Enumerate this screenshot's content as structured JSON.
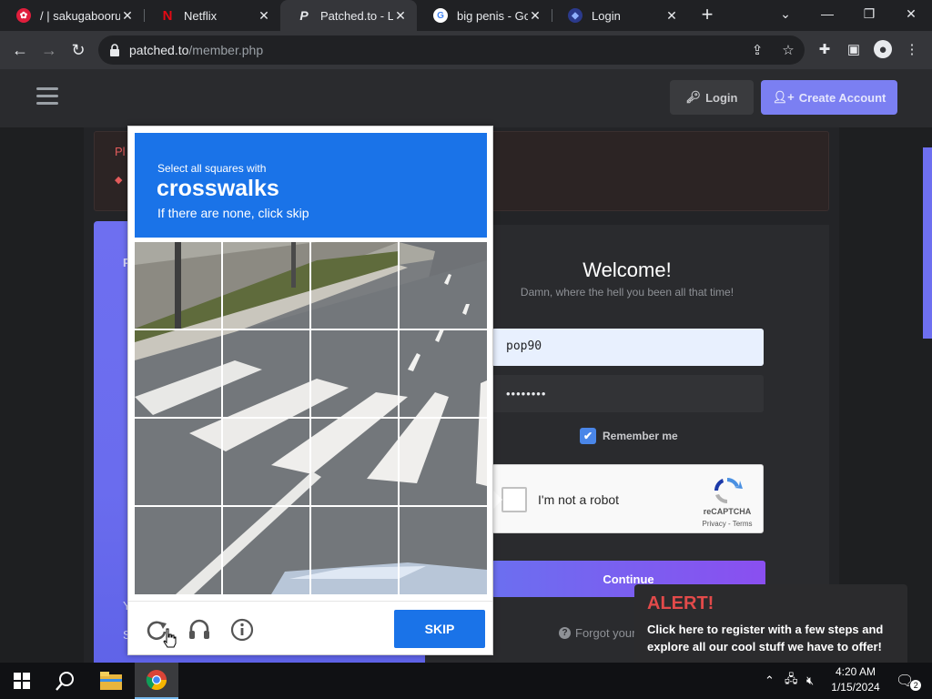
{
  "browser": {
    "tabs": [
      {
        "title": "/ | sakugabooru",
        "favicon": "sakugabooru-icon"
      },
      {
        "title": "Netflix",
        "favicon": "netflix-icon"
      },
      {
        "title": "Patched.to - Lo",
        "favicon": "patched-icon"
      },
      {
        "title": "big penis - Goo",
        "favicon": "google-icon"
      },
      {
        "title": "Login",
        "favicon": "login-icon"
      }
    ],
    "url_host": "patched.to",
    "url_path": "/member.php"
  },
  "site": {
    "login_label": "Login",
    "create_label": "Create Account",
    "error_text": "Pl",
    "purple_letters": [
      "P",
      "Y",
      "S"
    ]
  },
  "form": {
    "welcome": "Welcome!",
    "subtitle": "Damn, where the hell you been all that time!",
    "username": "pop90",
    "password": "••••••••",
    "remember": "Remember me",
    "robot": "I'm not a robot",
    "recaptcha_brand": "reCAPTCHA",
    "recaptcha_links": "Privacy - Terms",
    "continue": "Continue",
    "forgot": "Forgot your"
  },
  "alert": {
    "heading": "ALERT!",
    "body": "Click here to register with a few steps and explore all our cool stuff we have to offer!"
  },
  "captcha": {
    "select_text": "Select all squares with",
    "target": "crosswalks",
    "hint": "If there are none, click skip",
    "skip_label": "SKIP"
  },
  "taskbar": {
    "time": "4:20 AM",
    "date": "1/15/2024",
    "notifications": "2"
  },
  "colors": {
    "accent": "#7b7ff2",
    "captcha_blue": "#1a73e8",
    "alert_red": "#e24a4a"
  }
}
